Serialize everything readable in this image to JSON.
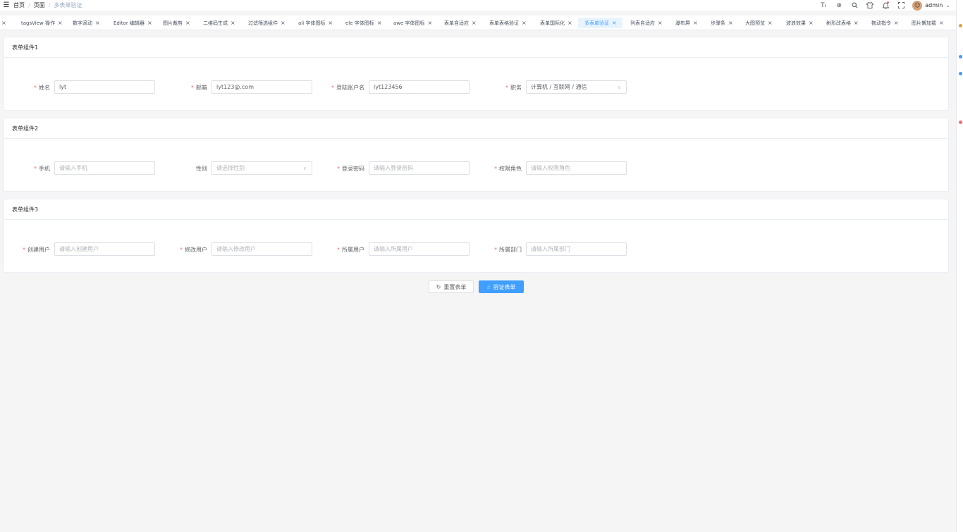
{
  "header": {
    "breadcrumb": [
      "首页",
      "页面",
      "多表单验证"
    ],
    "username": "admin"
  },
  "tags": [
    {
      "label": "",
      "active": false
    },
    {
      "label": "tagsView 操作",
      "active": false
    },
    {
      "label": "数字滚动",
      "active": false
    },
    {
      "label": "Editor 编辑器",
      "active": false
    },
    {
      "label": "图片裁剪",
      "active": false
    },
    {
      "label": "二维码生成",
      "active": false
    },
    {
      "label": "过滤筛选组件",
      "active": false
    },
    {
      "label": "ali 字体图标",
      "active": false
    },
    {
      "label": "ele 字体图标",
      "active": false
    },
    {
      "label": "awe 字体图标",
      "active": false
    },
    {
      "label": "表单自适应",
      "active": false
    },
    {
      "label": "表单表格验证",
      "active": false
    },
    {
      "label": "表单国际化",
      "active": false
    },
    {
      "label": "多表单验证",
      "active": true
    },
    {
      "label": "列表自适应",
      "active": false
    },
    {
      "label": "瀑布屏",
      "active": false
    },
    {
      "label": "步骤条",
      "active": false
    },
    {
      "label": "大图预览",
      "active": false
    },
    {
      "label": "波浪效果",
      "active": false
    },
    {
      "label": "树形改表格",
      "active": false
    },
    {
      "label": "拖动指令",
      "active": false
    },
    {
      "label": "图片懒加载",
      "active": false
    }
  ],
  "forms": [
    {
      "title": "表单组件1",
      "fields": [
        {
          "label": "姓名",
          "value": "lyt",
          "placeholder": "",
          "required": true,
          "select": false
        },
        {
          "label": "邮箱",
          "value": "lyt123@.com",
          "placeholder": "",
          "required": true,
          "select": false
        },
        {
          "label": "登陆账户名",
          "value": "lyt123456",
          "placeholder": "",
          "required": true,
          "select": false
        },
        {
          "label": "职务",
          "value": "计算机 / 互联网 / 通信",
          "placeholder": "",
          "required": true,
          "select": true
        }
      ]
    },
    {
      "title": "表单组件2",
      "fields": [
        {
          "label": "手机",
          "value": "",
          "placeholder": "请输入手机",
          "required": true,
          "select": false
        },
        {
          "label": "性别",
          "value": "",
          "placeholder": "请选择性别",
          "required": false,
          "select": true
        },
        {
          "label": "登录密码",
          "value": "",
          "placeholder": "请输入登录密码",
          "required": true,
          "select": false
        },
        {
          "label": "权限角色",
          "value": "",
          "placeholder": "请输入权限角色",
          "required": true,
          "select": false
        }
      ]
    },
    {
      "title": "表单组件3",
      "fields": [
        {
          "label": "创建用户",
          "value": "",
          "placeholder": "请输入创建用户",
          "required": true,
          "select": false
        },
        {
          "label": "修改用户",
          "value": "",
          "placeholder": "请输入修改用户",
          "required": true,
          "select": false
        },
        {
          "label": "所属用户",
          "value": "",
          "placeholder": "请输入所属用户",
          "required": true,
          "select": false
        },
        {
          "label": "所属部门",
          "value": "",
          "placeholder": "请输入所属部门",
          "required": true,
          "select": false
        }
      ]
    }
  ],
  "actions": {
    "reset_label": "重置表单",
    "verify_label": "验证表单"
  },
  "colors": {
    "primary": "#409eff",
    "required": "#f56c6c",
    "background": "#f5f5f5"
  }
}
